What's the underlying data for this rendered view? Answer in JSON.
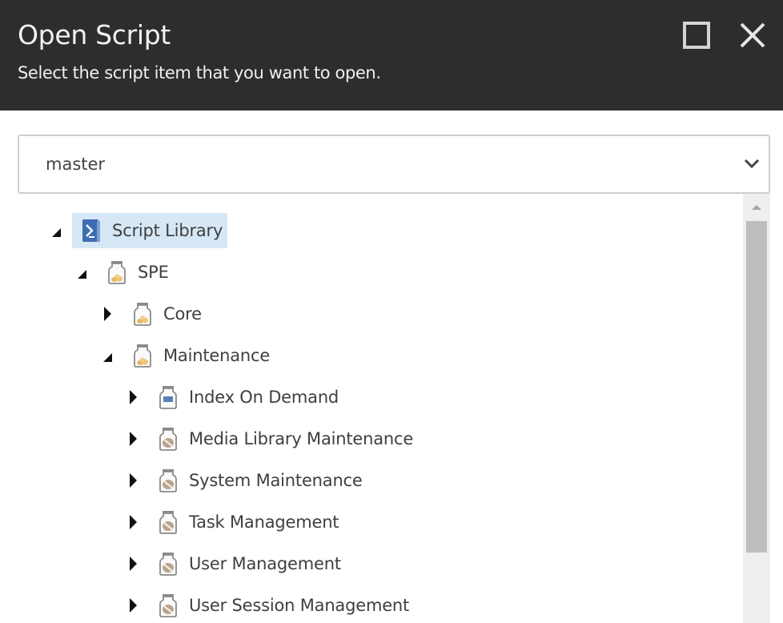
{
  "dialog": {
    "title": "Open Script",
    "subtitle": "Select the script item that you want to open.",
    "maximize_icon": "maximize-icon",
    "close_icon": "close-icon"
  },
  "database_select": {
    "value": "master",
    "icon": "chevron-down-icon"
  },
  "tree": {
    "items": [
      {
        "label": "Script Library",
        "level": 0,
        "state": "expanded",
        "icon": "powershell-library-icon",
        "selected": true
      },
      {
        "label": "SPE",
        "level": 1,
        "state": "expanded",
        "icon": "module-jar-icon",
        "selected": false
      },
      {
        "label": "Core",
        "level": 2,
        "state": "collapsed",
        "icon": "module-jar-icon",
        "selected": false
      },
      {
        "label": "Maintenance",
        "level": 2,
        "state": "expanded",
        "icon": "module-jar-icon",
        "selected": false
      },
      {
        "label": "Index On Demand",
        "level": 3,
        "state": "collapsed",
        "icon": "enabled-module-jar-icon",
        "selected": false
      },
      {
        "label": "Media Library Maintenance",
        "level": 3,
        "state": "collapsed",
        "icon": "disabled-module-jar-icon",
        "selected": false
      },
      {
        "label": "System Maintenance",
        "level": 3,
        "state": "collapsed",
        "icon": "disabled-module-jar-icon",
        "selected": false
      },
      {
        "label": "Task Management",
        "level": 3,
        "state": "collapsed",
        "icon": "disabled-module-jar-icon",
        "selected": false
      },
      {
        "label": "User Management",
        "level": 3,
        "state": "collapsed",
        "icon": "disabled-module-jar-icon",
        "selected": false
      },
      {
        "label": "User Session Management",
        "level": 3,
        "state": "collapsed",
        "icon": "disabled-module-jar-icon",
        "selected": false
      }
    ]
  },
  "colors": {
    "header_bg": "#2d2d2d",
    "selected_bg": "#d6e7f5",
    "scrollbar_track": "#efefef",
    "scrollbar_thumb": "#bdbdbd"
  }
}
